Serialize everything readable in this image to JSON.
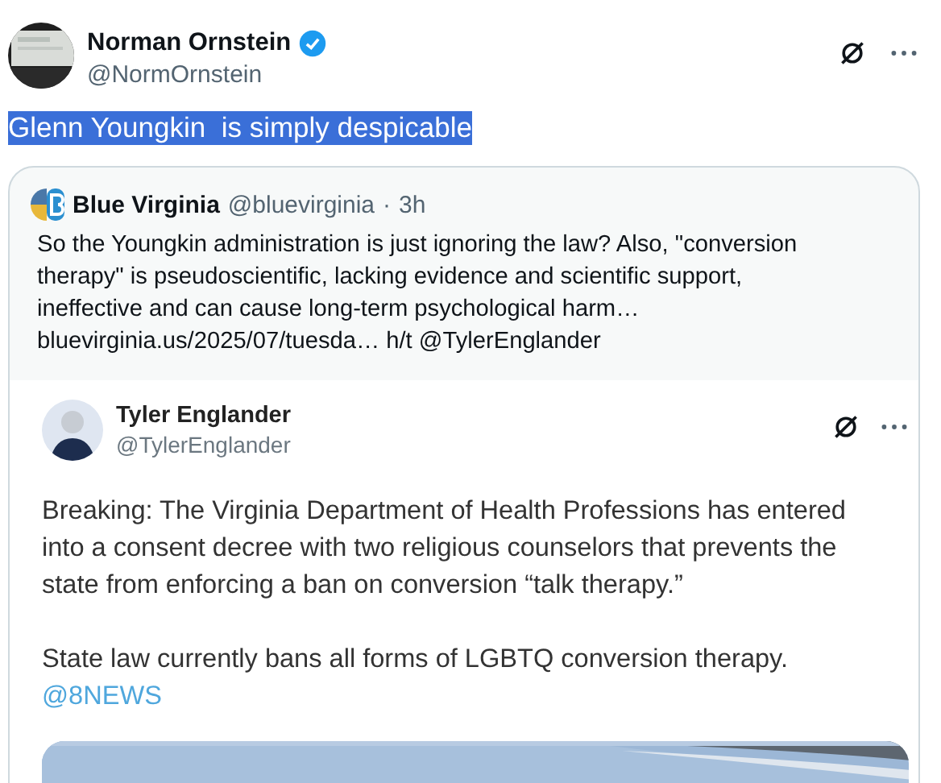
{
  "author": {
    "name": "Norman Ornstein",
    "verified": true,
    "handle": "@NormOrnstein"
  },
  "tweet": {
    "text": "Glenn Youngkin  is simply despicable",
    "highlighted": true
  },
  "quote": {
    "name": "Blue Virginia",
    "handle": "@bluevirginia",
    "separator": "·",
    "time": "3h",
    "text": "So the Youngkin administration is just ignoring the law? Also, \"conversion\ntherapy\" is pseudoscientific, lacking evidence and scientific support,\nineffective and can cause long-term psychological harm…\nbluevirginia.us/2025/07/tuesda… h/t @TylerEnglander"
  },
  "screenshot": {
    "name": "Tyler Englander",
    "handle": "@TylerEnglander",
    "paragraphs": [
      "Breaking: The Virginia Department of Health Professions has entered\ninto a consent decree with two religious counselors that prevents the\nstate from enforcing a ban on conversion “talk therapy.”",
      "State law currently bans all forms of LGBTQ conversion therapy."
    ],
    "mention": "@8NEWS"
  }
}
